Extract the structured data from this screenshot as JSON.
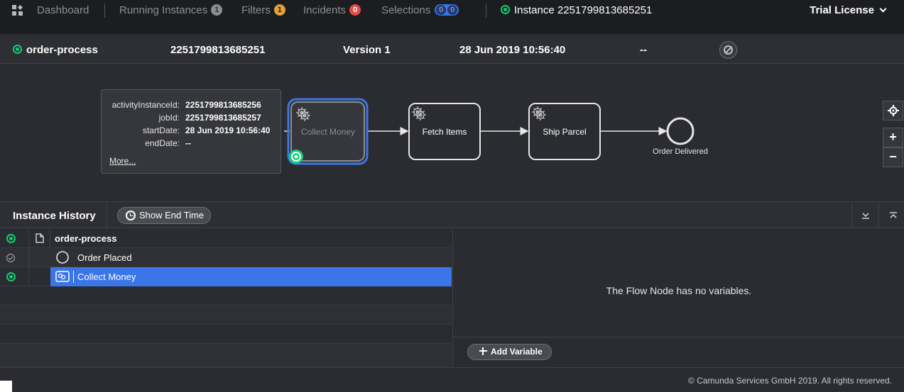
{
  "header": {
    "nav": {
      "dashboard": "Dashboard",
      "running_instances": "Running Instances",
      "running_count": "1",
      "filters": "Filters",
      "filters_count": "1",
      "incidents": "Incidents",
      "incidents_count": "0",
      "selections": "Selections",
      "selections_count_a": "0",
      "selections_count_b": "0",
      "instance": "Instance 2251799813685251"
    },
    "license": "Trial License"
  },
  "instance": {
    "process": "order-process",
    "id": "2251799813685251",
    "version": "Version 1",
    "start_date": "28 Jun 2019 10:56:40",
    "end_date": "--"
  },
  "diagram": {
    "popover": {
      "rows": [
        {
          "key": "activityInstanceId:",
          "value": "2251799813685256"
        },
        {
          "key": "jobId:",
          "value": "2251799813685257"
        },
        {
          "key": "startDate:",
          "value": "28 Jun 2019 10:56:40"
        },
        {
          "key": "endDate:",
          "value": "--"
        }
      ],
      "more": "More..."
    },
    "tasks": [
      "Collect Money",
      "Fetch Items",
      "Ship Parcel"
    ],
    "end_event": "Order Delivered",
    "zoom_in": "+",
    "zoom_out": "−"
  },
  "history": {
    "title": "Instance History",
    "show_end_time": "Show End Time",
    "rows": [
      {
        "label": "order-process",
        "state": "active"
      },
      {
        "label": "Order Placed",
        "state": "completed"
      },
      {
        "label": "Collect Money",
        "state": "active"
      }
    ]
  },
  "variables": {
    "empty": "The Flow Node has no variables.",
    "add": "Add Variable"
  },
  "footer": {
    "copyright": "© Camunda Services GmbH 2019. All rights reserved."
  },
  "colors": {
    "accent": "#3a76e8",
    "ok": "#10d070",
    "incident": "#e64b46",
    "filter": "#e6a23c"
  }
}
